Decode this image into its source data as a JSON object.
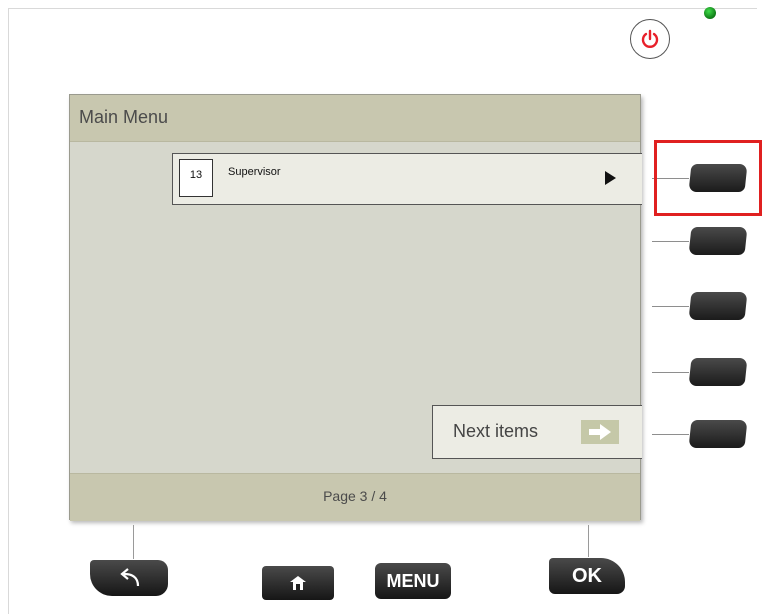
{
  "screen": {
    "title": "Main Menu",
    "menu_items": [
      {
        "number": "13",
        "label": "Supervisor"
      }
    ],
    "next_button": {
      "label": "Next items"
    },
    "page_indicator": "Page 3 / 4"
  },
  "hardware_buttons": {
    "menu_label": "MENU",
    "ok_label": "OK"
  },
  "side_softkeys": [
    "softkey-1",
    "softkey-2",
    "softkey-3",
    "softkey-4",
    "softkey-5"
  ],
  "icons": {
    "power": "power-icon",
    "back": "back-arrow-icon",
    "home": "home-icon",
    "next": "right-arrow-icon",
    "status_led": "status-led"
  },
  "colors": {
    "screen_bg": "#d6d7cc",
    "header_bg": "#c8c7af",
    "item_bg": "#ecece4",
    "power_red": "#e8202a",
    "led_green": "#1fb52b",
    "highlight_red": "#e02020"
  }
}
